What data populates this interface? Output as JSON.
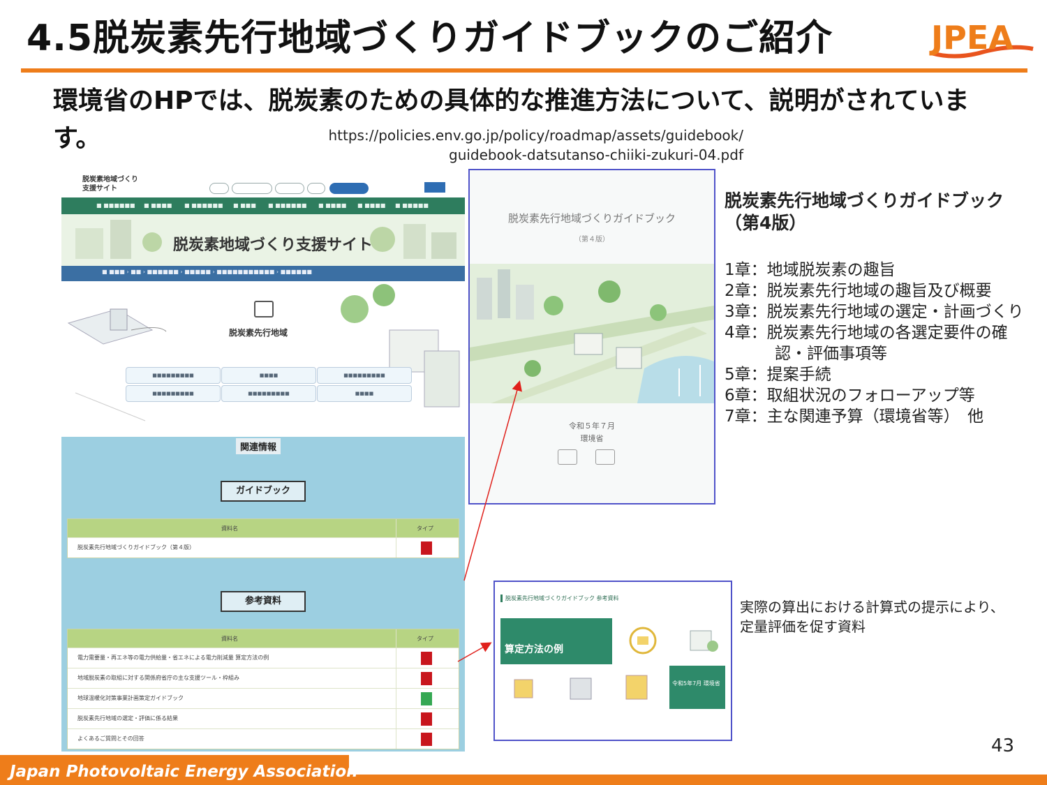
{
  "title": "4.5脱炭素先行地域づくりガイドブックのご紹介",
  "logo_text": "JPEA",
  "intro": "環境省のHPでは、脱炭素のための具体的な推進方法について、説明がされています。",
  "url": {
    "line1": "https://policies.env.go.jp/policy/roadmap/assets/guidebook/",
    "line2": "guidebook-datsutanso-chiiki-zukuri-04.pdf"
  },
  "website": {
    "site_name_line1": "脱炭素地域づくり",
    "site_name_line2": "支援サイト",
    "hero_title": "脱炭素地域づくり支援サイト",
    "section_title": "脱炭素先行地域",
    "related_heading": "関連情報",
    "guidebook_box": "ガイドブック",
    "guidebook_table": {
      "header_name": "資料名",
      "header_type": "タイプ",
      "rows": [
        {
          "name": "脱炭素先行地域づくりガイドブック（第４版）",
          "type": "pdf"
        }
      ]
    },
    "reference_box": "参考資料",
    "reference_table": {
      "header_name": "資料名",
      "header_type": "タイプ",
      "rows": [
        {
          "name": "電力需要量・再エネ等の電力供給量・省エネによる電力削減量 算定方法の例",
          "type": "pdf"
        },
        {
          "name": "地域脱炭素の取組に対する関係府省庁の主な支援ツール・枠組み",
          "type": "pdf"
        },
        {
          "name": "地球温暖化対策事業計画策定ガイドブック",
          "type": "xls"
        },
        {
          "name": "脱炭素先行地域の選定・評価に係る結果",
          "type": "pdf"
        },
        {
          "name": "よくあるご質問とその回答",
          "type": "pdf"
        }
      ]
    }
  },
  "cover": {
    "title": "脱炭素先行地域づくりガイドブック",
    "edition": "（第４版）",
    "date": "令和５年７月",
    "org": "環境省"
  },
  "guidebook": {
    "title": "脱炭素先行地域づくりガイドブック（第4版）",
    "chapters": [
      "1章：地域脱炭素の趣旨",
      "2章：脱炭素先行地域の趣旨及び概要",
      "3章：脱炭素先行地域の選定・計画づくり",
      "4章：脱炭素先行地域の各選定要件の確",
      "認・評価事項等",
      "5章：提案手続",
      "6章：取組状況のフォローアップ等",
      "7章：主な関連予算（環境省等）　他"
    ]
  },
  "reference": {
    "header": "脱炭素先行地域づくりガイドブック 参考資料",
    "example": "算定方法の例",
    "date_org": "令和5年7月 環境省",
    "description": "実際の算出における計算式の提示により、定量評価を促す資料"
  },
  "page_number": "43",
  "footer": "Japan Photovoltaic Energy Association",
  "colors": {
    "accent": "#ee7d1a",
    "frame": "#4f52c9",
    "site_green": "#2e7d5e",
    "arrow": "#e0201b"
  }
}
